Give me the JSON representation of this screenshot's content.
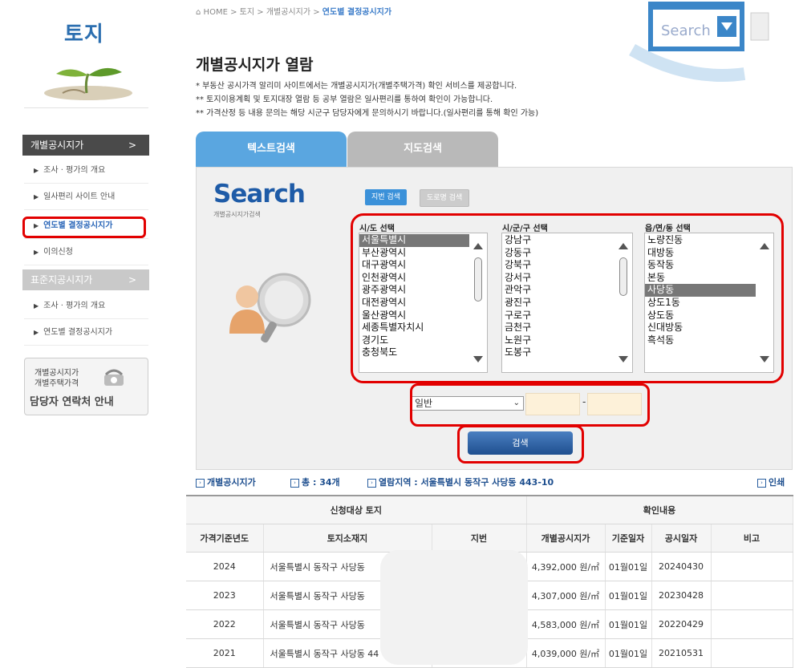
{
  "breadcrumb": {
    "home": "HOME",
    "sep": ">",
    "level1": "토지",
    "level2": "개별공시지가",
    "current": "연도별 결정공시지가"
  },
  "sidebar": {
    "title": "토지",
    "section1": "개별공시지가",
    "section1_items": [
      "조사 · 평가의 개요",
      "일사편리 사이트 안내",
      "연도별 결정공시지가",
      "이의신청"
    ],
    "section2": "표준지공시지가",
    "section2_items": [
      "조사 · 평가의 개요",
      "연도별 결정공시지가"
    ],
    "chevron": ">",
    "contact": {
      "line1": "개별공시지가",
      "line2": "개별주택가격",
      "line3": "담당자 연락처 안내"
    }
  },
  "page": {
    "title": "개별공시지가 열람",
    "desc": [
      "* 부동산 공시가격 알리미 사이트에서는 개별공시지가(개별주택가격) 확인 서비스를 제공합니다.",
      "** 토지이용계획 및 토지대장 열람 등 공부 열람은 일사편리를 통하여 확인이 가능합니다.",
      "** 가격산정 등 내용 문의는 해당 시군구 담당자에게 문의하시기 바랍니다.(일사편리를 통해 확인 가능)"
    ],
    "header_search_word": "Search"
  },
  "tabs": {
    "text_search": "텍스트검색",
    "map_search": "지도검색"
  },
  "search_panel": {
    "logo": "Search",
    "logo_sub": "개별공시지가검색",
    "btn_jibun": "지번 검색",
    "btn_road": "도로명 검색",
    "sido_label": "시/도 선택",
    "sigungu_label": "시/군/구 선택",
    "dong_label": "읍/면/동 선택",
    "sido_options": [
      "서울특별시",
      "부산광역시",
      "대구광역시",
      "인천광역시",
      "광주광역시",
      "대전광역시",
      "울산광역시",
      "세종특별자치시",
      "경기도",
      "충청북도"
    ],
    "sido_selected": 0,
    "sigungu_options": [
      "강남구",
      "강동구",
      "강북구",
      "강서구",
      "관악구",
      "광진구",
      "구로구",
      "금천구",
      "노원구",
      "도봉구"
    ],
    "dong_options": [
      "노량진동",
      "대방동",
      "동작동",
      "본동",
      "사당동",
      "상도1동",
      "상도동",
      "신대방동",
      "흑석동"
    ],
    "dong_selected": 4,
    "type_select": "일반",
    "dash": "-",
    "search_button": "검색"
  },
  "summary": {
    "label1": "개별공시지가",
    "total_label": "총 : ",
    "total_value": "34개",
    "region_label": "열람지역 : ",
    "region_value": "서울특별시 동작구 사당동 443-10",
    "print": "인쇄"
  },
  "table": {
    "group1": "신청대상 토지",
    "group2": "확인내용",
    "headers": [
      "가격기준년도",
      "토지소재지",
      "지번",
      "개별공시지가",
      "기준일자",
      "공시일자",
      "비고"
    ],
    "rows": [
      [
        "2024",
        "서울특별시 동작구 사당동",
        "",
        "4,392,000 원/㎡",
        "01월01일",
        "20240430",
        ""
      ],
      [
        "2023",
        "서울특별시 동작구 사당동",
        "",
        "4,307,000 원/㎡",
        "01월01일",
        "20230428",
        ""
      ],
      [
        "2022",
        "서울특별시 동작구 사당동",
        "",
        "4,583,000 원/㎡",
        "01월01일",
        "20220429",
        ""
      ],
      [
        "2021",
        "서울특별시 동작구 사당동 44",
        "",
        "4,039,000 원/㎡",
        "01월01일",
        "20210531",
        ""
      ]
    ]
  },
  "colors": {
    "accent": "#2c6fb0",
    "highlight": "#e20000",
    "tab_active": "#5aa6e0",
    "tab_inactive": "#b9b9b9"
  }
}
